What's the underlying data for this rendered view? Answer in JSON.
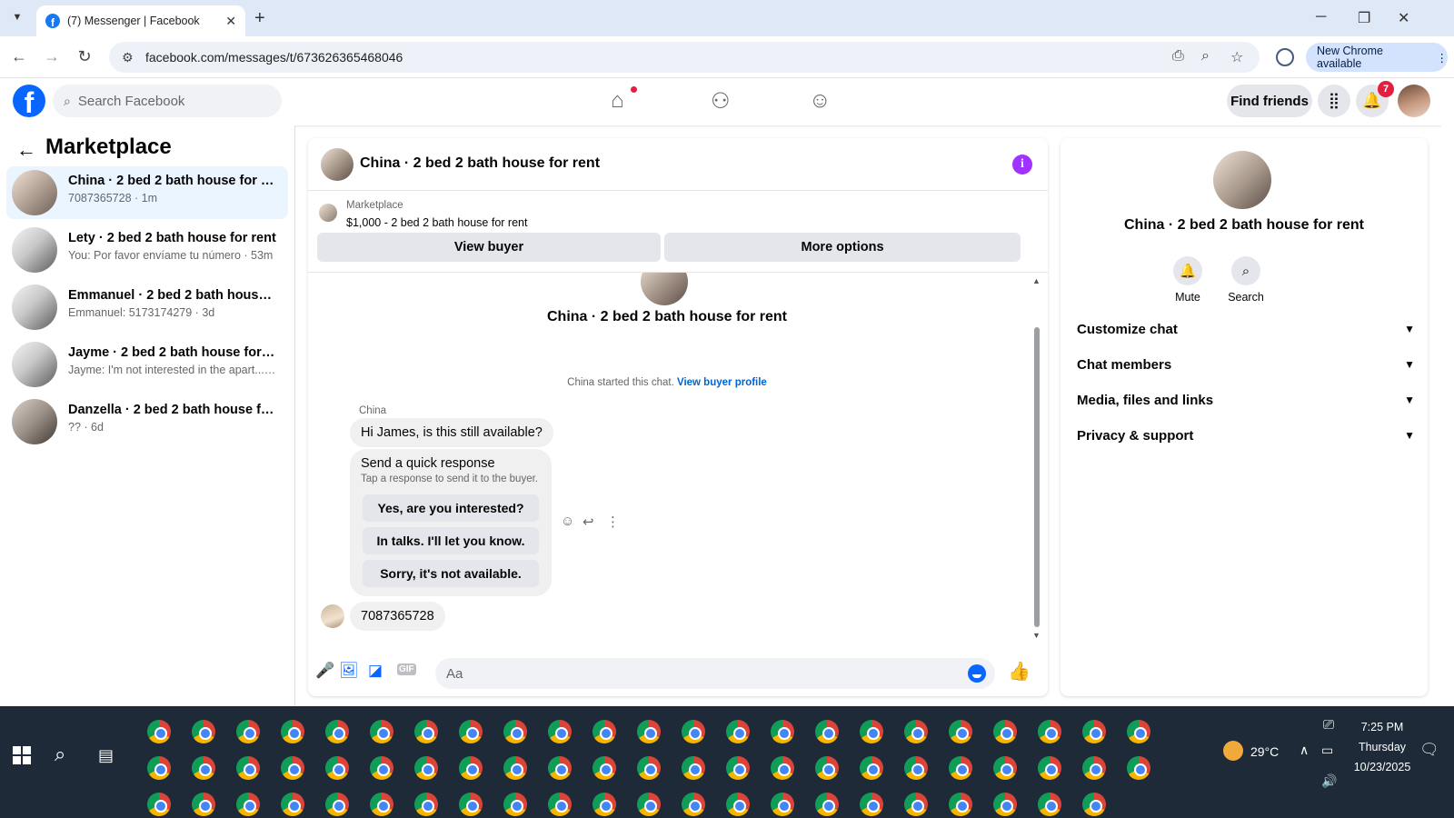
{
  "browser": {
    "tab_title": "(7) Messenger | Facebook",
    "url": "facebook.com/messages/t/673626365468046",
    "new_chrome": "New Chrome available"
  },
  "fb": {
    "logo": "f",
    "search_placeholder": "Search Facebook",
    "find_friends": "Find friends",
    "notif_count": "7"
  },
  "left": {
    "title": "Marketplace",
    "conversations": [
      {
        "name": "China · 2 bed 2 bath house for rent",
        "sub": "7087365728 · 1m"
      },
      {
        "name": "Lety · 2 bed 2 bath house for rent",
        "sub": "You: Por favor envíame tu número · 53m"
      },
      {
        "name": "Emmanuel · 2 bed 2 bath house for rent",
        "sub": "Emmanuel: 5173174279 · 3d"
      },
      {
        "name": "Jayme · 2 bed 2 bath house for rent",
        "sub": "Jayme: I'm not interested in the apart... · 3d"
      },
      {
        "name": "Danzella · 2 bed 2 bath house for rent",
        "sub": "?? · 6d"
      }
    ]
  },
  "chat": {
    "title": "China · 2 bed 2 bath house for rent",
    "info_glyph": "i",
    "marketplace_label": "Marketplace",
    "listing": "$1,000 - 2 bed 2 bath house for rent",
    "view_buyer": "View buyer",
    "more_options": "More options",
    "intro_title": "China · 2 bed 2 bath house for rent",
    "started_text": "China started this chat.",
    "view_buyer_profile": "View buyer profile",
    "sender": "China",
    "message1": "Hi James, is this still available?",
    "quick_title": "Send a quick response",
    "quick_sub": "Tap a response to send it to the buyer.",
    "quick_responses": [
      "Yes, are you interested?",
      "In talks. I'll let you know.",
      "Sorry, it's not available."
    ],
    "message2": "7087365728",
    "composer_placeholder": "Aa"
  },
  "right": {
    "name": "China · 2 bed 2 bath house for rent",
    "mute": "Mute",
    "search": "Search",
    "sections": [
      "Customize chat",
      "Chat members",
      "Media, files and links",
      "Privacy & support"
    ]
  },
  "taskbar": {
    "weather": "29°C",
    "time": "7:25 PM",
    "day": "Thursday",
    "date": "10/23/2025"
  }
}
